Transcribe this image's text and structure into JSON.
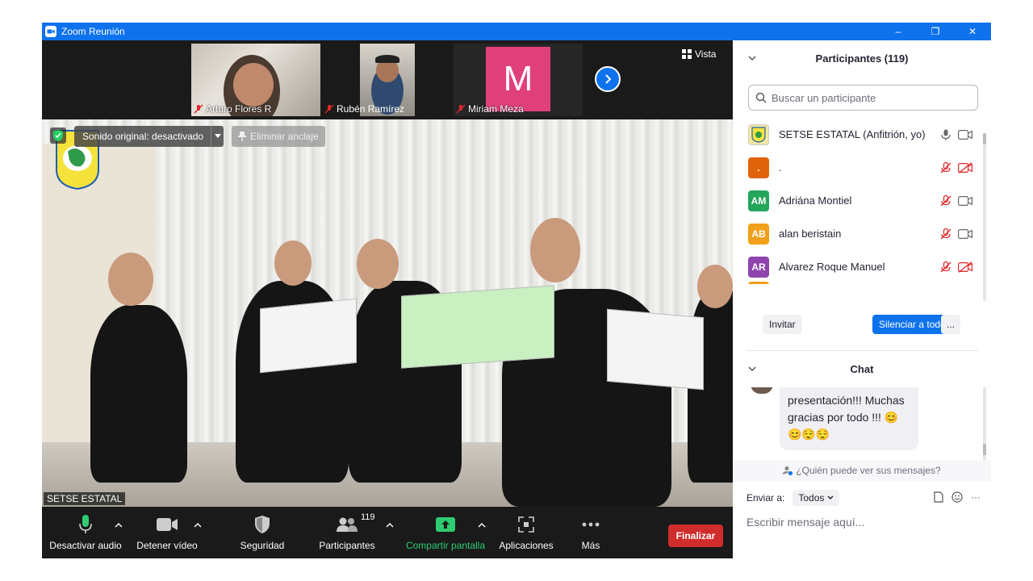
{
  "window": {
    "title": "Zoom Reunión",
    "controls": {
      "minimize": "–",
      "restore": "❐",
      "close": "✕"
    }
  },
  "thumbnails": [
    {
      "name": "Arturo Flores R",
      "muted": true
    },
    {
      "name": "Rubén Ramírez",
      "muted": true
    },
    {
      "name": "Miriam Meza",
      "muted": true,
      "avatar_letter": "M",
      "avatar_color": "#e0407a"
    }
  ],
  "view_button": {
    "label": "Vista"
  },
  "main_video": {
    "speaker_name": "SETSE ESTATAL",
    "sound_chip": "Sonido original: desactivado",
    "unpin_label": "Eliminar anclaje"
  },
  "toolbar": {
    "items": [
      {
        "label": "Desactivar audio",
        "icon": "mic-icon"
      },
      {
        "label": "Detener vídeo",
        "icon": "video-icon"
      },
      {
        "label": "Seguridad",
        "icon": "shield-icon"
      },
      {
        "label": "Participantes",
        "icon": "participants-icon",
        "count": "119"
      },
      {
        "label": "Compartir pantalla",
        "icon": "share-screen-icon"
      },
      {
        "label": "Aplicaciones",
        "icon": "apps-icon"
      },
      {
        "label": "Más",
        "icon": "more-icon"
      }
    ],
    "end_label": "Finalizar"
  },
  "participants_panel": {
    "title": "Participantes (119)",
    "search_placeholder": "Buscar un participante",
    "rows": [
      {
        "initials": "",
        "name": "SETSE ESTATAL (Anfitrión, yo)",
        "color": "#f2e8a0",
        "mic": "on",
        "cam": "on"
      },
      {
        "initials": ".",
        "name": ".",
        "color": "#e0630a",
        "mic": "off",
        "cam": "off"
      },
      {
        "initials": "AM",
        "name": "Adriána Montiel",
        "color": "#23a55a",
        "mic": "off",
        "cam": "on"
      },
      {
        "initials": "AB",
        "name": "alan beristain",
        "color": "#f0a01a",
        "mic": "off",
        "cam": "on"
      },
      {
        "initials": "AR",
        "name": "Alvarez Roque Manuel",
        "color": "#8e44ad",
        "mic": "off",
        "cam": "off"
      }
    ],
    "invite_label": "Invitar",
    "mute_all_label": "Silenciar a todos",
    "more_label": "..."
  },
  "chat_panel": {
    "title": "Chat",
    "message_line1": "presentación!!! Muchas",
    "message_line2": "gracias por todo !!! 😊",
    "message_line3": "😊😌😌",
    "who_can_see": "¿Quién puede ver sus mensajes?",
    "send_to_label": "Enviar a:",
    "send_to_value": "Todos",
    "input_placeholder": "Escribir mensaje aquí...",
    "more_label": "···"
  },
  "colors": {
    "accent": "#0e72ed",
    "end_button": "#d12c2c",
    "share_green": "#2ecc71",
    "muted_red": "#e02828"
  }
}
